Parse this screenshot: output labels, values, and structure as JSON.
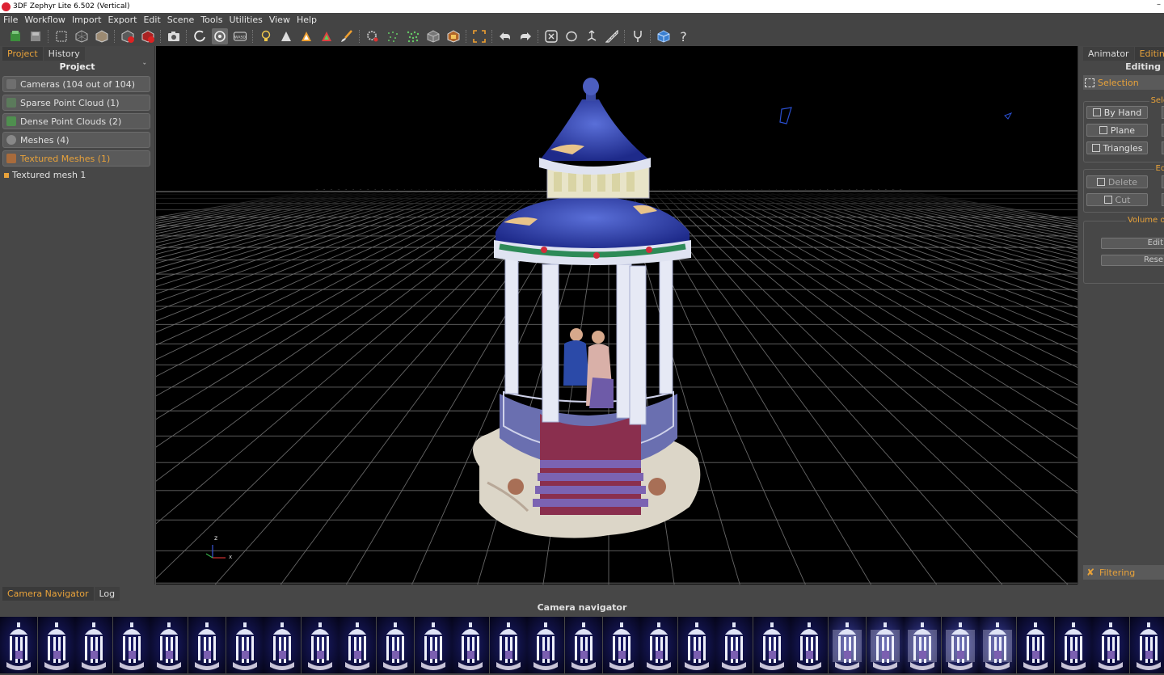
{
  "window": {
    "title": "3DF Zephyr Lite 6.502 (Vertical)",
    "minimize_glyph": "–"
  },
  "menu": [
    "File",
    "Workflow",
    "Import",
    "Export",
    "Edit",
    "Scene",
    "Tools",
    "Utilities",
    "View",
    "Help"
  ],
  "toolbar": {
    "icons": [
      "new-project-icon",
      "save-icon",
      "select-box-icon",
      "mesh-wire-icon",
      "mesh-solid-icon",
      "texture-red-icon",
      "texture-red2-icon",
      "camera-icon",
      "orbit-icon",
      "orbit-active-icon",
      "wasd-icon",
      "lightbulb-icon",
      "cone-icon",
      "cone-orange-icon",
      "cone-red-icon",
      "brush-icon",
      "gear-dots-icon",
      "dots-icon",
      "dots2-icon",
      "cube-icon",
      "cube-color-icon",
      "frame-icon",
      "undo-icon",
      "redo-icon",
      "select-tool-icon",
      "lasso-icon",
      "transform-icon",
      "ruler-icon",
      "fork-icon",
      "cube-blue-icon",
      "help-icon"
    ],
    "wasd_label": "WASD",
    "help_label": "?"
  },
  "left_panel": {
    "tabs": [
      "Project",
      "History"
    ],
    "active_tab": "Project",
    "title": "Project",
    "pin": "ˇ",
    "items": [
      {
        "label": "Cameras (104 out of 104)",
        "highlight": false,
        "color": "#6f6f6f"
      },
      {
        "label": "Sparse Point Cloud (1)",
        "highlight": false,
        "color": "#5b7a5b"
      },
      {
        "label": "Dense Point Clouds (2)",
        "highlight": false,
        "color": "#4f8f4f"
      },
      {
        "label": "Meshes (4)",
        "highlight": false,
        "color": "#888888"
      },
      {
        "label": "Textured Meshes (1)",
        "highlight": true,
        "color": "#a86b3c"
      }
    ],
    "tree": [
      {
        "label": "Textured mesh 1"
      }
    ]
  },
  "viewport": {
    "axis_z": "z",
    "axis_x": "x",
    "background": "#000000"
  },
  "right_panel": {
    "tabs": [
      "Animator",
      "Editing"
    ],
    "active_tab": "Editing",
    "title": "Editing",
    "selection_label": "Selection",
    "select_caption": "Sele",
    "select_buttons": [
      "By Hand",
      "Plane",
      "Triangles"
    ],
    "edit_caption": "Edi",
    "edit_buttons": [
      "Delete",
      "Cut"
    ],
    "volume_caption": "Volume of",
    "volume_buttons": [
      "Edit",
      "Rese"
    ],
    "filtering_label": "Filtering"
  },
  "bottom_panel": {
    "tabs": [
      "Camera Navigator",
      "Log"
    ],
    "active_tab": "Camera Navigator",
    "title": "Camera navigator",
    "thumb_count": 31
  },
  "colors": {
    "accent": "#e8a23a",
    "panel": "#474747",
    "viewport": "#000000"
  }
}
